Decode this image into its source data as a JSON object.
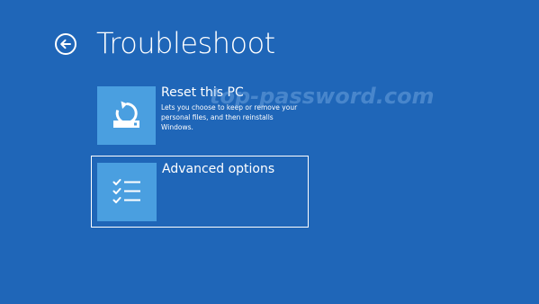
{
  "page": {
    "title": "Troubleshoot",
    "background_color": "#1f66b8"
  },
  "back": {
    "icon": "back-arrow-circle-icon"
  },
  "options": [
    {
      "label": "Reset this PC",
      "description": "Lets you choose to keep or remove your personal files, and then reinstalls Windows.",
      "icon": "reset-pc-icon",
      "selected": false
    },
    {
      "label": "Advanced options",
      "description": "",
      "icon": "checklist-icon",
      "selected": true
    }
  ],
  "watermark": {
    "text": "top-password.com"
  },
  "colors": {
    "tile": "#4a9fe0",
    "text": "#ffffff",
    "focus_border": "#ffffff"
  }
}
